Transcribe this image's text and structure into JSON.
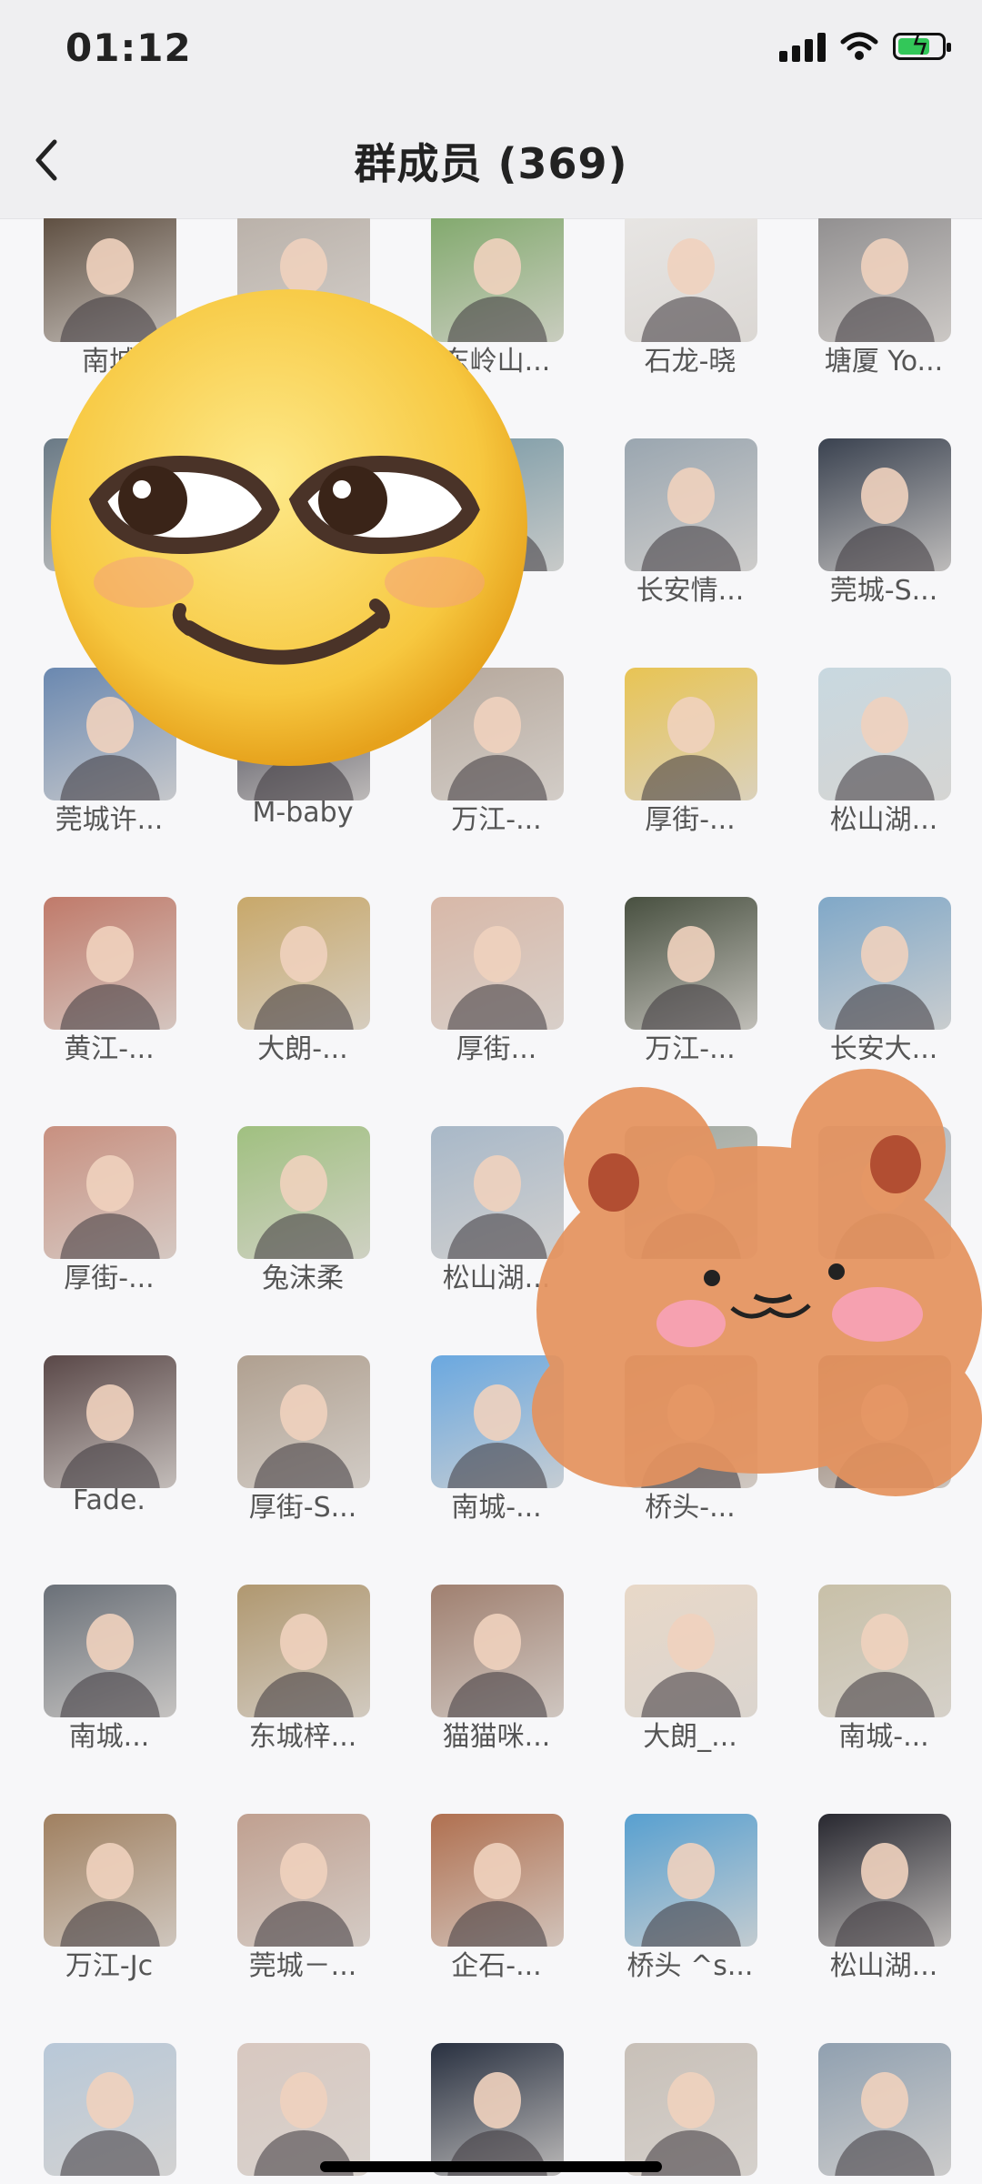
{
  "status": {
    "time": "01:12"
  },
  "header": {
    "title": "群成员 (369)"
  },
  "members": [
    [
      "南城",
      "",
      "东岭山...",
      "石龙-晓",
      "塘厦 Yo..."
    ],
    [
      "",
      "",
      "",
      "长安情...",
      "莞城-S..."
    ],
    [
      "莞城许...",
      "M-baby",
      "万江-...",
      "厚街-...",
      "松山湖..."
    ],
    [
      "黄江-...",
      "大朗-...",
      "厚街...",
      "万江-...",
      "长安大..."
    ],
    [
      "厚街-...",
      "兔沫柔",
      "松山湖...",
      "",
      ""
    ],
    [
      "Fade.",
      "厚街-S...",
      "南城-...",
      "桥头-...",
      ""
    ],
    [
      "南城...",
      "东城梓...",
      "猫猫咪...",
      "大朗_...",
      "南城-..."
    ],
    [
      "万江-Jc",
      "莞城－...",
      "企石-...",
      "桥头 ^s...",
      "松山湖..."
    ],
    [
      "",
      "",
      "",
      "",
      ""
    ]
  ],
  "avatar_colors": [
    [
      "#5a4a3c",
      "#b9b0a8",
      "#7fa86a",
      "#e8e6e4",
      "#8f8d8e"
    ],
    [
      "#6a7a86",
      "#a89a8a",
      "#7a9aa6",
      "#9aa6b0",
      "#3a4250"
    ],
    [
      "#6a88b0",
      "#3a3a48",
      "#b6a89c",
      "#e8c454",
      "#c8d8e0"
    ],
    [
      "#c07a6a",
      "#c8a86a",
      "#d8b8a8",
      "#485040",
      "#80a8c8"
    ],
    [
      "#c89080",
      "#a0c080",
      "#a8b8c8",
      "#a0a8a0",
      "#b0b8c0"
    ],
    [
      "#5a4848",
      "#b0a090",
      "#6aa8e0",
      "#a89080",
      "#887060"
    ],
    [
      "#6a7078",
      "#b09870",
      "#a08070",
      "#e8d8c8",
      "#c8c0a8"
    ],
    [
      "#a08060",
      "#c0a090",
      "#b07050",
      "#58a0d0",
      "#282830"
    ],
    [
      "#b8c8d8",
      "#d8c8c0",
      "#283040",
      "#c8c0b8",
      "#90a0b0"
    ]
  ],
  "icons": {
    "back": "chevron-left-icon",
    "sticker1": "smug-smiley-icon",
    "sticker2": "crayon-bear-icon"
  }
}
